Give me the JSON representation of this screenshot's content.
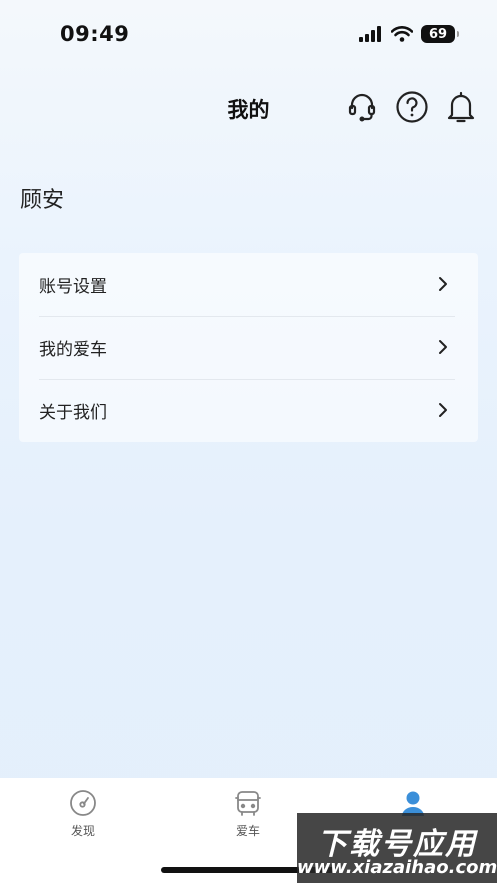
{
  "status_bar": {
    "time": "09:49",
    "battery": "69"
  },
  "header": {
    "title": "我的"
  },
  "icons": {
    "headset": "headset-icon",
    "help": "question-icon",
    "bell": "bell-icon",
    "chevron": "chevron-right-icon"
  },
  "user": {
    "name": "顾安"
  },
  "menu": {
    "items": [
      {
        "label": "账号设置"
      },
      {
        "label": "我的爱车"
      },
      {
        "label": "关于我们"
      }
    ]
  },
  "tabbar": {
    "tabs": [
      {
        "label": "发现",
        "icon": "compass-icon"
      },
      {
        "label": "爱车",
        "icon": "car-icon"
      },
      {
        "label": "",
        "icon": "person-icon",
        "active": true
      }
    ],
    "active_color": "#3b8fd9"
  },
  "watermark": {
    "title": "下载号应用",
    "url": "www.xiazaihao.com"
  }
}
